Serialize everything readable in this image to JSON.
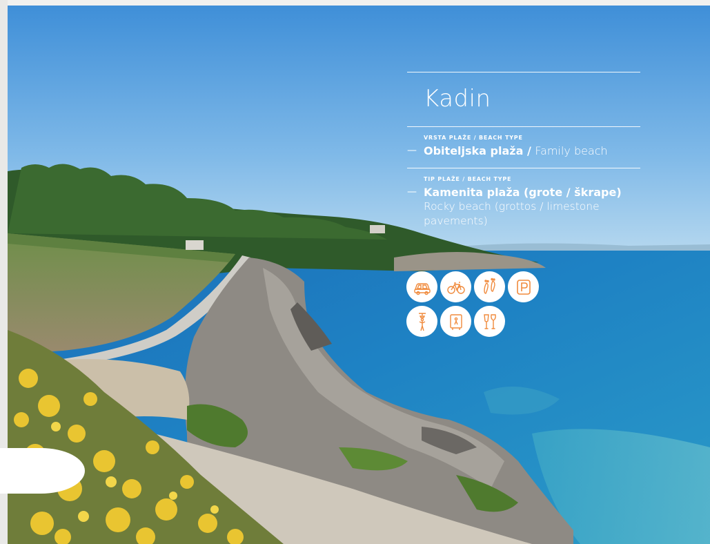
{
  "beach": {
    "name": "Kadin",
    "section1_label": "VRSTA PLAŽE / BEACH TYPE",
    "section1_hr": "Obiteljska plaža",
    "section1_sep": " / ",
    "section1_en": "Family beach",
    "section2_label": "TIP PLAŽE / BEACH TYPE",
    "section2_hr": "Kamenita plaža (grote / škrape)",
    "section2_en": "Rocky beach (grottos / limestone pavements)",
    "dash": "—"
  },
  "icons": {
    "row1": [
      "car-icon",
      "bicycle-icon",
      "footprints-icon",
      "parking-icon"
    ],
    "row2": [
      "shower-icon",
      "restroom-icon",
      "bar-icon"
    ],
    "color": "#f08a3c"
  }
}
